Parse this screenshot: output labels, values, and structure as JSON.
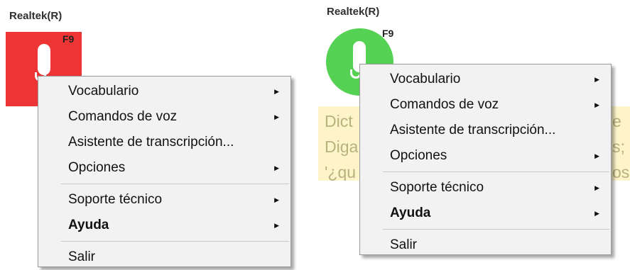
{
  "left": {
    "device_label": "Realtek(R)",
    "hotkey": "F9",
    "state_color": "#ee3535",
    "menu": {
      "group1": [
        {
          "label": "Vocabulario",
          "submenu": true
        },
        {
          "label": "Comandos de voz",
          "submenu": true
        },
        {
          "label": "Asistente de transcripción...",
          "submenu": false
        },
        {
          "label": "Opciones",
          "submenu": true
        }
      ],
      "group2": [
        {
          "label": "Soporte técnico",
          "submenu": true
        },
        {
          "label": "Ayuda",
          "submenu": true
        }
      ],
      "group3": [
        {
          "label": "Salir",
          "submenu": false
        }
      ]
    }
  },
  "right": {
    "device_label": "Realtek(R)",
    "hotkey": "F9",
    "state_color": "#55d154",
    "dictation_lines": [
      {
        "start": "Dict",
        "end": "e"
      },
      {
        "start": "Diga",
        "end": "s;"
      },
      {
        "start": "'¿qu",
        "end": "os"
      }
    ],
    "menu": {
      "group1": [
        {
          "label": "Vocabulario",
          "submenu": true
        },
        {
          "label": "Comandos de voz",
          "submenu": true
        },
        {
          "label": "Asistente de transcripción...",
          "submenu": false
        },
        {
          "label": "Opciones",
          "submenu": true
        }
      ],
      "group2": [
        {
          "label": "Soporte técnico",
          "submenu": true
        },
        {
          "label": "Ayuda",
          "submenu": true
        }
      ],
      "group3": [
        {
          "label": "Salir",
          "submenu": false
        }
      ]
    }
  },
  "icons": {
    "microphone": "microphone-icon",
    "submenu_arrow": "chevron-right-icon",
    "arrow_glyph": "▶"
  }
}
